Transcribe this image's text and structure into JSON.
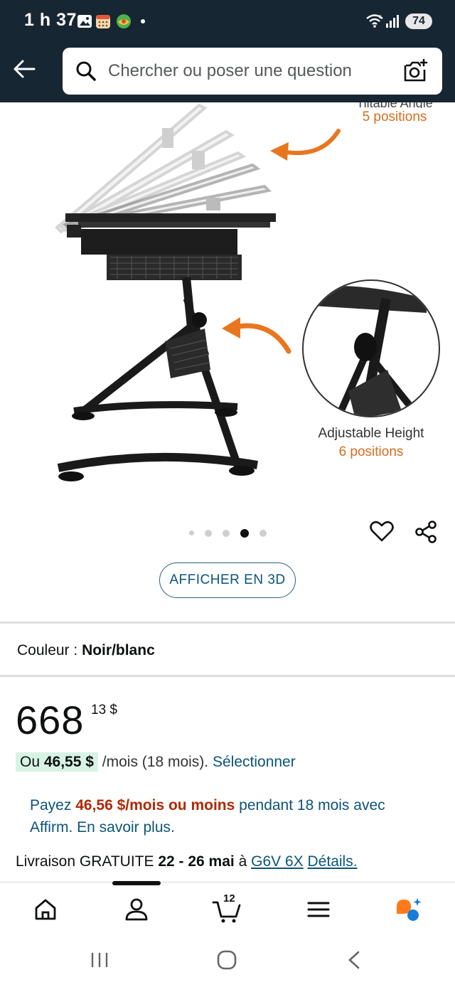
{
  "status_bar": {
    "time": "1 h 37",
    "battery": "74"
  },
  "header": {
    "search_placeholder": "Chercher ou poser une question"
  },
  "product_image": {
    "tilt_caption_title": "Tiltable Angle",
    "tilt_caption_positions": "5 positions",
    "height_caption_title": "Adjustable Height",
    "height_caption_positions": "6 positions",
    "carousel_total": 5,
    "carousel_active_index": 3
  },
  "view_3d_label": "AFFICHER EN 3D",
  "color": {
    "label": "Couleur :",
    "value": "Noir/blanc"
  },
  "price": {
    "whole": "668",
    "cents": "13 $"
  },
  "monthly": {
    "prefix": "Ou",
    "amount": "46,55 $",
    "suffix": "/mois (18 mois).",
    "link": "Sélectionner"
  },
  "affirm": {
    "prefix": "Payez",
    "amount": "46,56 $/mois ou moins",
    "suffix": "pendant 18 mois avec Affirm. En savoir plus."
  },
  "delivery": {
    "prefix": "Livraison GRATUITE",
    "dates": "22 - 26 mai",
    "at": "à",
    "postal_code": "G6V 6X",
    "details_link": "Détails."
  },
  "bottom_nav": {
    "cart_count": "12"
  },
  "colors": {
    "header_bg": "#172633",
    "link": "#0b5478",
    "orange_accent": "#d86c1c",
    "price_red": "#b12704",
    "pill_green": "#d7f3e6"
  }
}
